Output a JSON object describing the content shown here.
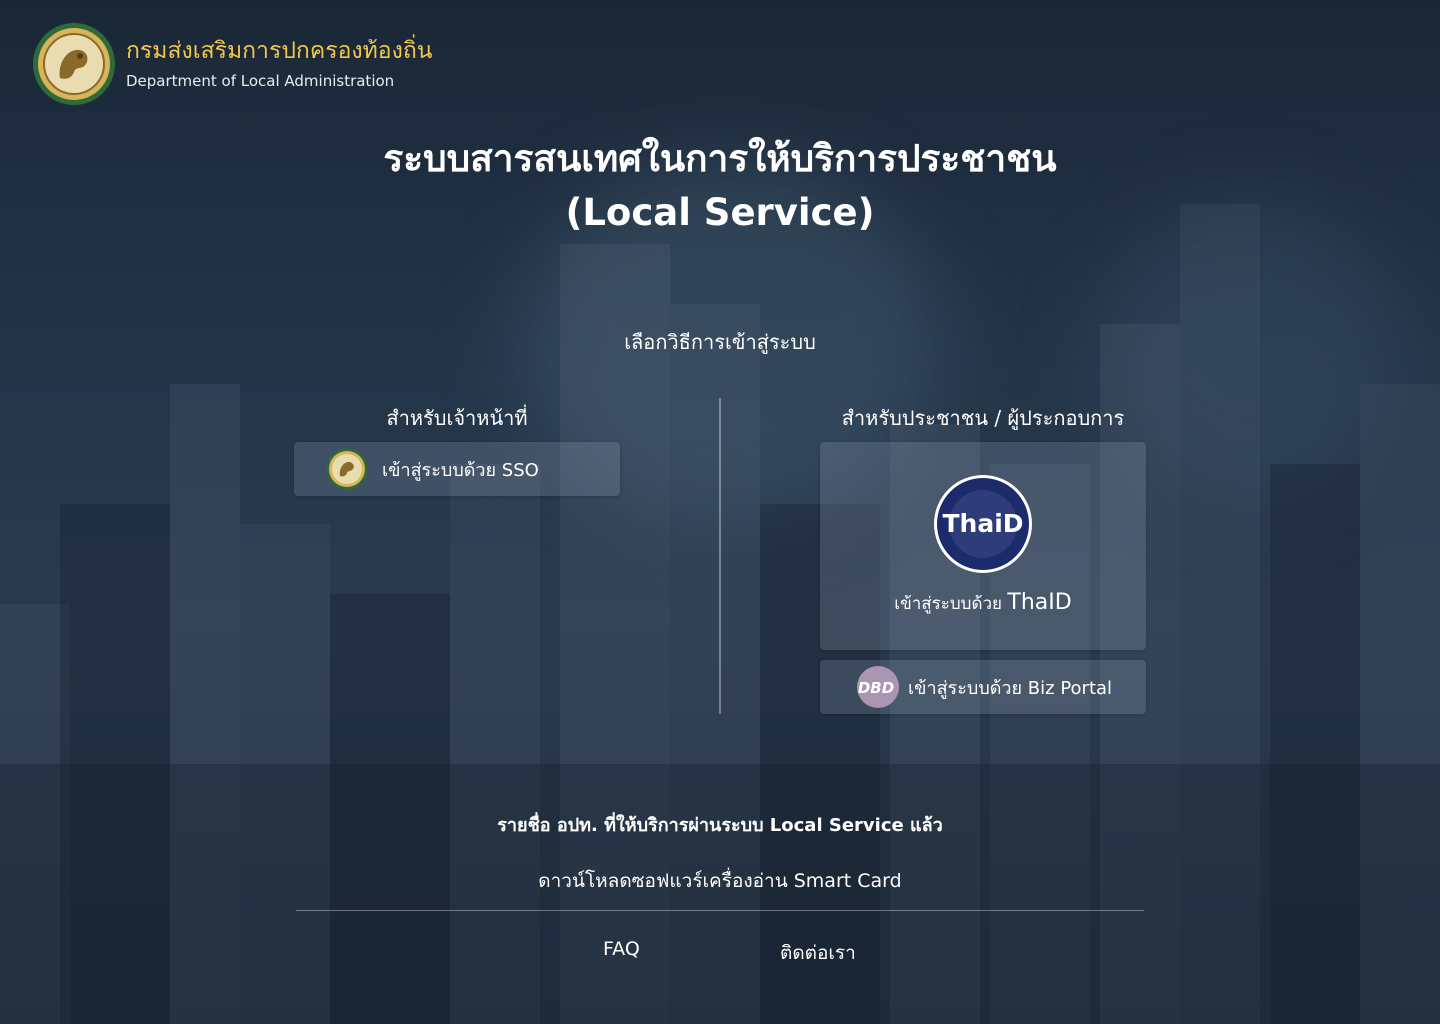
{
  "brand": {
    "name_th": "กรมส่งเสริมการปกครองท้องถิ่น",
    "name_en": "Department of Local Administration",
    "accent_color": "#f3c84b"
  },
  "title": {
    "line1": "ระบบสารสนเทศในการให้บริการประชาชน",
    "line2": "(Local Service)"
  },
  "login": {
    "heading": "เลือกวิธีการเข้าสู่ระบบ",
    "officer": {
      "heading": "สำหรับเจ้าหน้าที่",
      "sso_label": "เข้าสู่ระบบด้วย SSO"
    },
    "citizen": {
      "heading": "สำหรับประชาชน / ผู้ประกอบการ",
      "thaid_prefix": "เข้าสู่ระบบด้วย",
      "thaid_name": "ThaID",
      "thaid_logo_text": "ThaiD",
      "biz_label": "เข้าสู่ระบบด้วย Biz Portal",
      "dbd_logo_text": "DBD"
    }
  },
  "links": {
    "service_list": "รายชื่อ อปท. ที่ให้บริการผ่านระบบ Local Service แล้ว",
    "smartcard_download": "ดาวน์โหลดซอฟแวร์เครื่องอ่าน Smart Card"
  },
  "footer": {
    "faq": "FAQ",
    "contact": "ติดต่อเรา"
  },
  "icons": {
    "seal": "dla-seal-icon",
    "thaid": "thaid-logo-icon",
    "dbd": "dbd-logo-icon"
  }
}
